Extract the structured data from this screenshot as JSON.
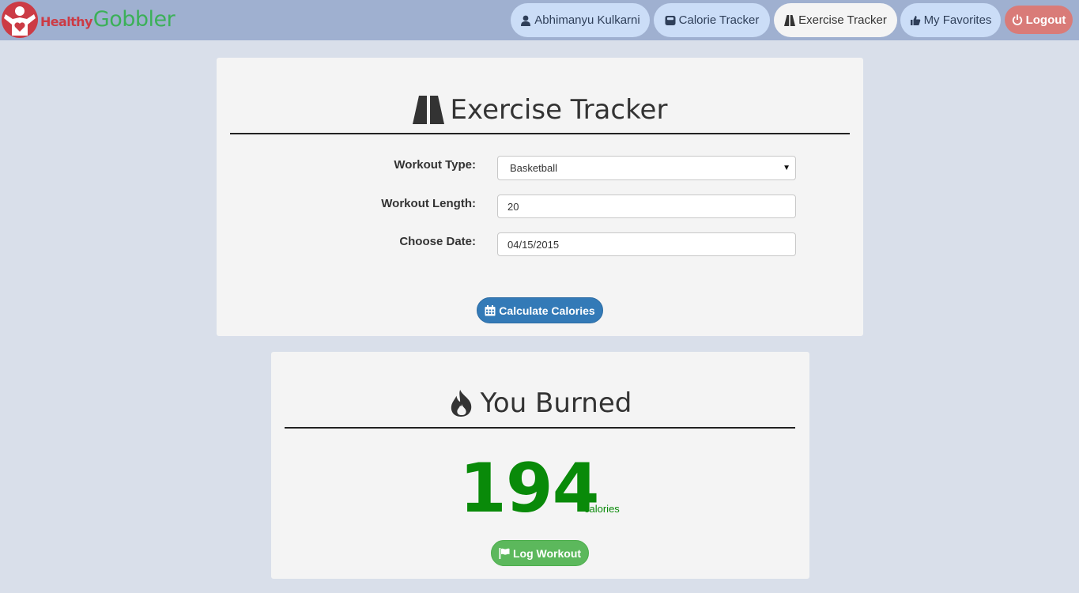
{
  "brand": {
    "healthy": "Healthy",
    "gobbler": "Gobbler",
    "logo_icon": "healthy-gobbler-logo-icon"
  },
  "nav": {
    "user": {
      "label": "Abhimanyu Kulkarni",
      "icon": "user-icon"
    },
    "calorie": {
      "label": "Calorie Tracker",
      "icon": "scale-icon"
    },
    "exercise": {
      "label": "Exercise Tracker",
      "icon": "road-icon",
      "active": true
    },
    "favorites": {
      "label": "My Favorites",
      "icon": "thumbs-up-icon"
    },
    "logout": {
      "label": "Logout",
      "icon": "power-icon"
    }
  },
  "tracker": {
    "title": "Exercise Tracker",
    "title_icon": "road-icon",
    "workout_type": {
      "label": "Workout Type:",
      "value": "Basketball"
    },
    "workout_length": {
      "label": "Workout Length:",
      "value": "20"
    },
    "date": {
      "label": "Choose Date:",
      "value": "04/15/2015"
    },
    "calculate": {
      "label": "Calculate Calories",
      "icon": "calendar-icon"
    }
  },
  "result": {
    "title": "You Burned",
    "title_icon": "fire-icon",
    "calories": "194",
    "unit": "calories",
    "log": {
      "label": "Log Workout",
      "icon": "flag-icon"
    }
  },
  "colors": {
    "navbar": "#9fb0d0",
    "nav_pill": "#cbddf7",
    "logout": "#d97b78",
    "primary_button": "#337ab7",
    "success_button": "#5cb85c",
    "calories_green": "#098a09",
    "background": "#d9dfea"
  }
}
